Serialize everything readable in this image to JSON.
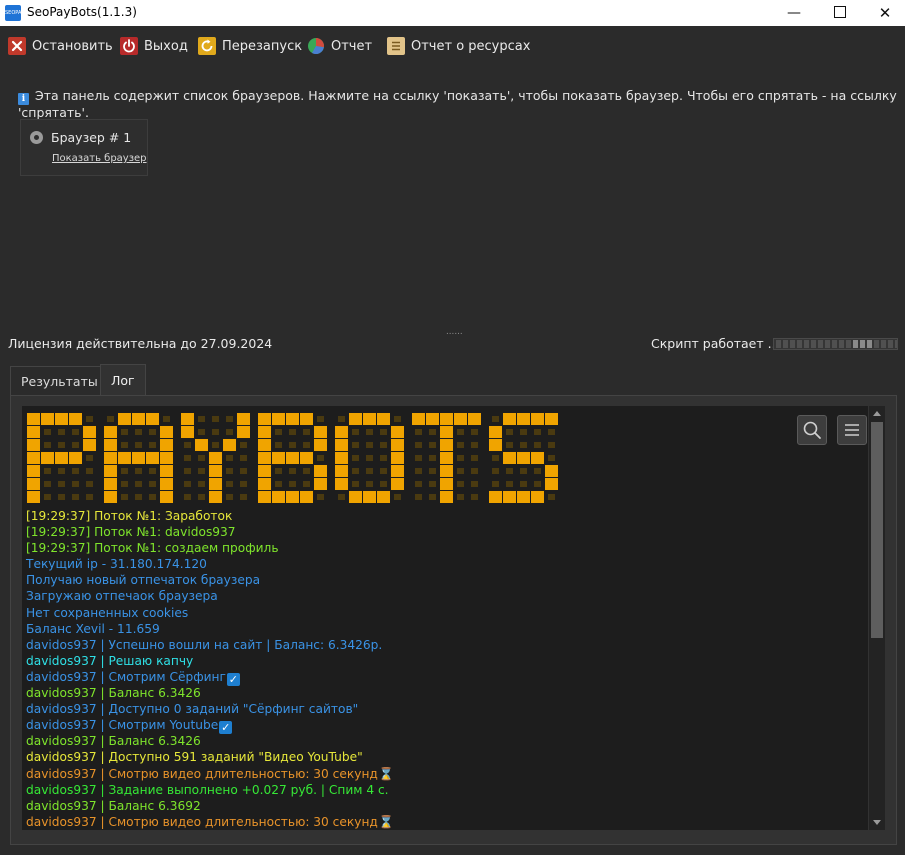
{
  "window": {
    "title": "SeoPayBots(1.1.3)",
    "app_icon_text": "SEOPAY",
    "minimize": "—",
    "close": "✕"
  },
  "toolbar": {
    "stop": "Остановить",
    "exit": "Выход",
    "restart": "Перезапуск",
    "report": "Отчет",
    "resource_report": "Отчет о ресурсах"
  },
  "browsers": {
    "info": "Эта панель содержит список браузеров. Нажмите на ссылку 'показать', чтобы показать браузер. Чтобы его спрятать - на ссылку 'спрятать'.",
    "info_icon_glyph": "i",
    "items": [
      {
        "title": "Браузер # 1",
        "link": "Показать браузер"
      }
    ]
  },
  "splitter_glyph": "......",
  "status": {
    "license": "Лицензия действительна до 27.09.2024",
    "script": "Скрипт работает ...",
    "progress_active_from": 0.56,
    "progress_active_to": 0.76
  },
  "tabs": [
    {
      "label": "Результаты",
      "active": false
    },
    {
      "label": "Лог",
      "active": true
    }
  ],
  "log": {
    "banner_text": "PAYBOTS",
    "banner_color": "#f0a400",
    "lines": [
      {
        "text": "[19:29:37] Поток №1: Заработок",
        "color": "#e7e83a"
      },
      {
        "text": "[19:29:37] Поток №1: davidos937",
        "color": "#7fe52c"
      },
      {
        "text": "[19:29:37] Поток №1: создаем профиль",
        "color": "#7fe52c"
      },
      {
        "text": "Текущий ip - 31.180.174.120",
        "color": "#3a93e6"
      },
      {
        "text": "Получаю новый отпечаток браузера",
        "color": "#3a93e6"
      },
      {
        "text": "Загружаю отпечаок браузера",
        "color": "#3a93e6"
      },
      {
        "text": "Нет сохраненных cookies",
        "color": "#3a93e6"
      },
      {
        "text": "Баланс Xevil - 11.659",
        "color": "#3a93e6"
      },
      {
        "text": "davidos937 | Успешно вошли на сайт | Баланс: 6.3426р.",
        "color": "#3a93e6"
      },
      {
        "text": "davidos937 | Решаю капчу",
        "color": "#2fe0e6"
      },
      {
        "text": "davidos937 | Смотрим Сёрфинг",
        "color": "#3a93e6",
        "mark": "check"
      },
      {
        "text": "davidos937 | Баланс 6.3426",
        "color": "#7fe52c"
      },
      {
        "text": "davidos937 | Доступно 0 заданий \"Сёрфинг сайтов\"",
        "color": "#3a93e6"
      },
      {
        "text": "davidos937 | Смотрим Youtube",
        "color": "#3a93e6",
        "mark": "check"
      },
      {
        "text": "davidos937 | Баланс 6.3426",
        "color": "#7fe52c"
      },
      {
        "text": "davidos937 | Доступно 591 заданий \"Видео YouTube\"",
        "color": "#e7e83a"
      },
      {
        "text": "davidos937 | Смотрю видео длительностью: 30 секунд",
        "color": "#e8932a",
        "mark": "hourglass"
      },
      {
        "text": "davidos937 | Задание выполнено +0.027 руб. | Спим 4 с.",
        "color": "#36e836"
      },
      {
        "text": "davidos937 | Баланс 6.3692",
        "color": "#7fe52c"
      },
      {
        "text": "davidos937 | Смотрю видео длительностью: 30 секунд",
        "color": "#e8932a",
        "mark": "hourglass"
      }
    ],
    "check_glyph": "✓",
    "hourglass_glyph": "⌛"
  },
  "icons": {
    "stop": "close-x-icon",
    "exit": "power-icon",
    "restart": "refresh-icon",
    "report": "pie-chart-icon",
    "resource_report": "list-icon",
    "info": "info-icon",
    "browser": "browser-globe-icon",
    "log_search": "search-icon",
    "log_menu": "hamburger-menu-icon"
  }
}
